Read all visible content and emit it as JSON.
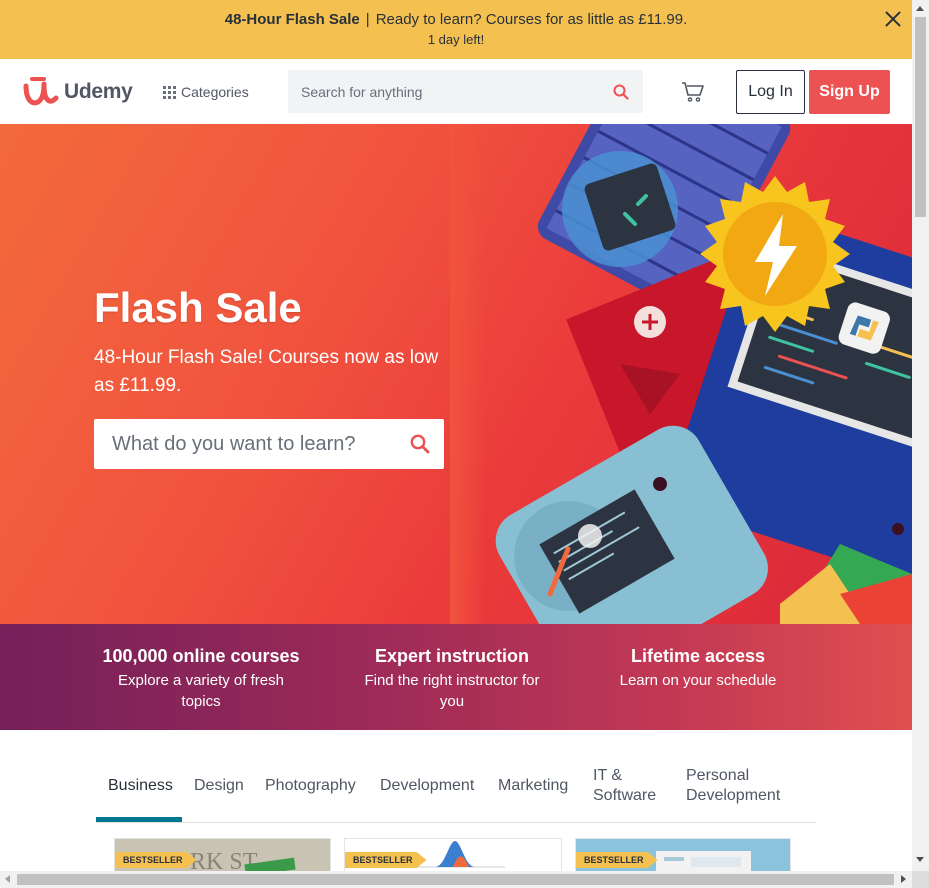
{
  "banner": {
    "title": "48-Hour Flash Sale",
    "separator": "|",
    "message": "Ready to learn? Courses for as little as £11.99.",
    "countdown": "1 day left!",
    "bg_color": "#f4c150"
  },
  "header": {
    "logo_text": "Udemy",
    "categories_label": "Categories",
    "search_placeholder": "Search for anything",
    "login_label": "Log In",
    "signup_label": "Sign Up",
    "brand_color": "#ec5252"
  },
  "hero": {
    "title": "Flash Sale",
    "subtitle": "48-Hour Flash Sale! Courses now as low as £11.99.",
    "search_placeholder": "What do you want to learn?"
  },
  "value_props": [
    {
      "title": "100,000 online courses",
      "desc": "Explore a variety of fresh topics"
    },
    {
      "title": "Expert instruction",
      "desc": "Find the right instructor for you"
    },
    {
      "title": "Lifetime access",
      "desc": "Learn on your schedule"
    }
  ],
  "tabs": [
    {
      "label": "Business",
      "active": true
    },
    {
      "label": "Design"
    },
    {
      "label": "Photography"
    },
    {
      "label": "Development"
    },
    {
      "label": "Marketing"
    },
    {
      "label": "IT & Software"
    },
    {
      "label": "Personal Development"
    }
  ],
  "courses": [
    {
      "badge": "BESTSELLER"
    },
    {
      "badge": "BESTSELLER"
    },
    {
      "badge": "BESTSELLER"
    }
  ],
  "colors": {
    "tab_active": "#007791",
    "value_band_start": "#74205a",
    "value_band_end": "#e04f4f"
  }
}
